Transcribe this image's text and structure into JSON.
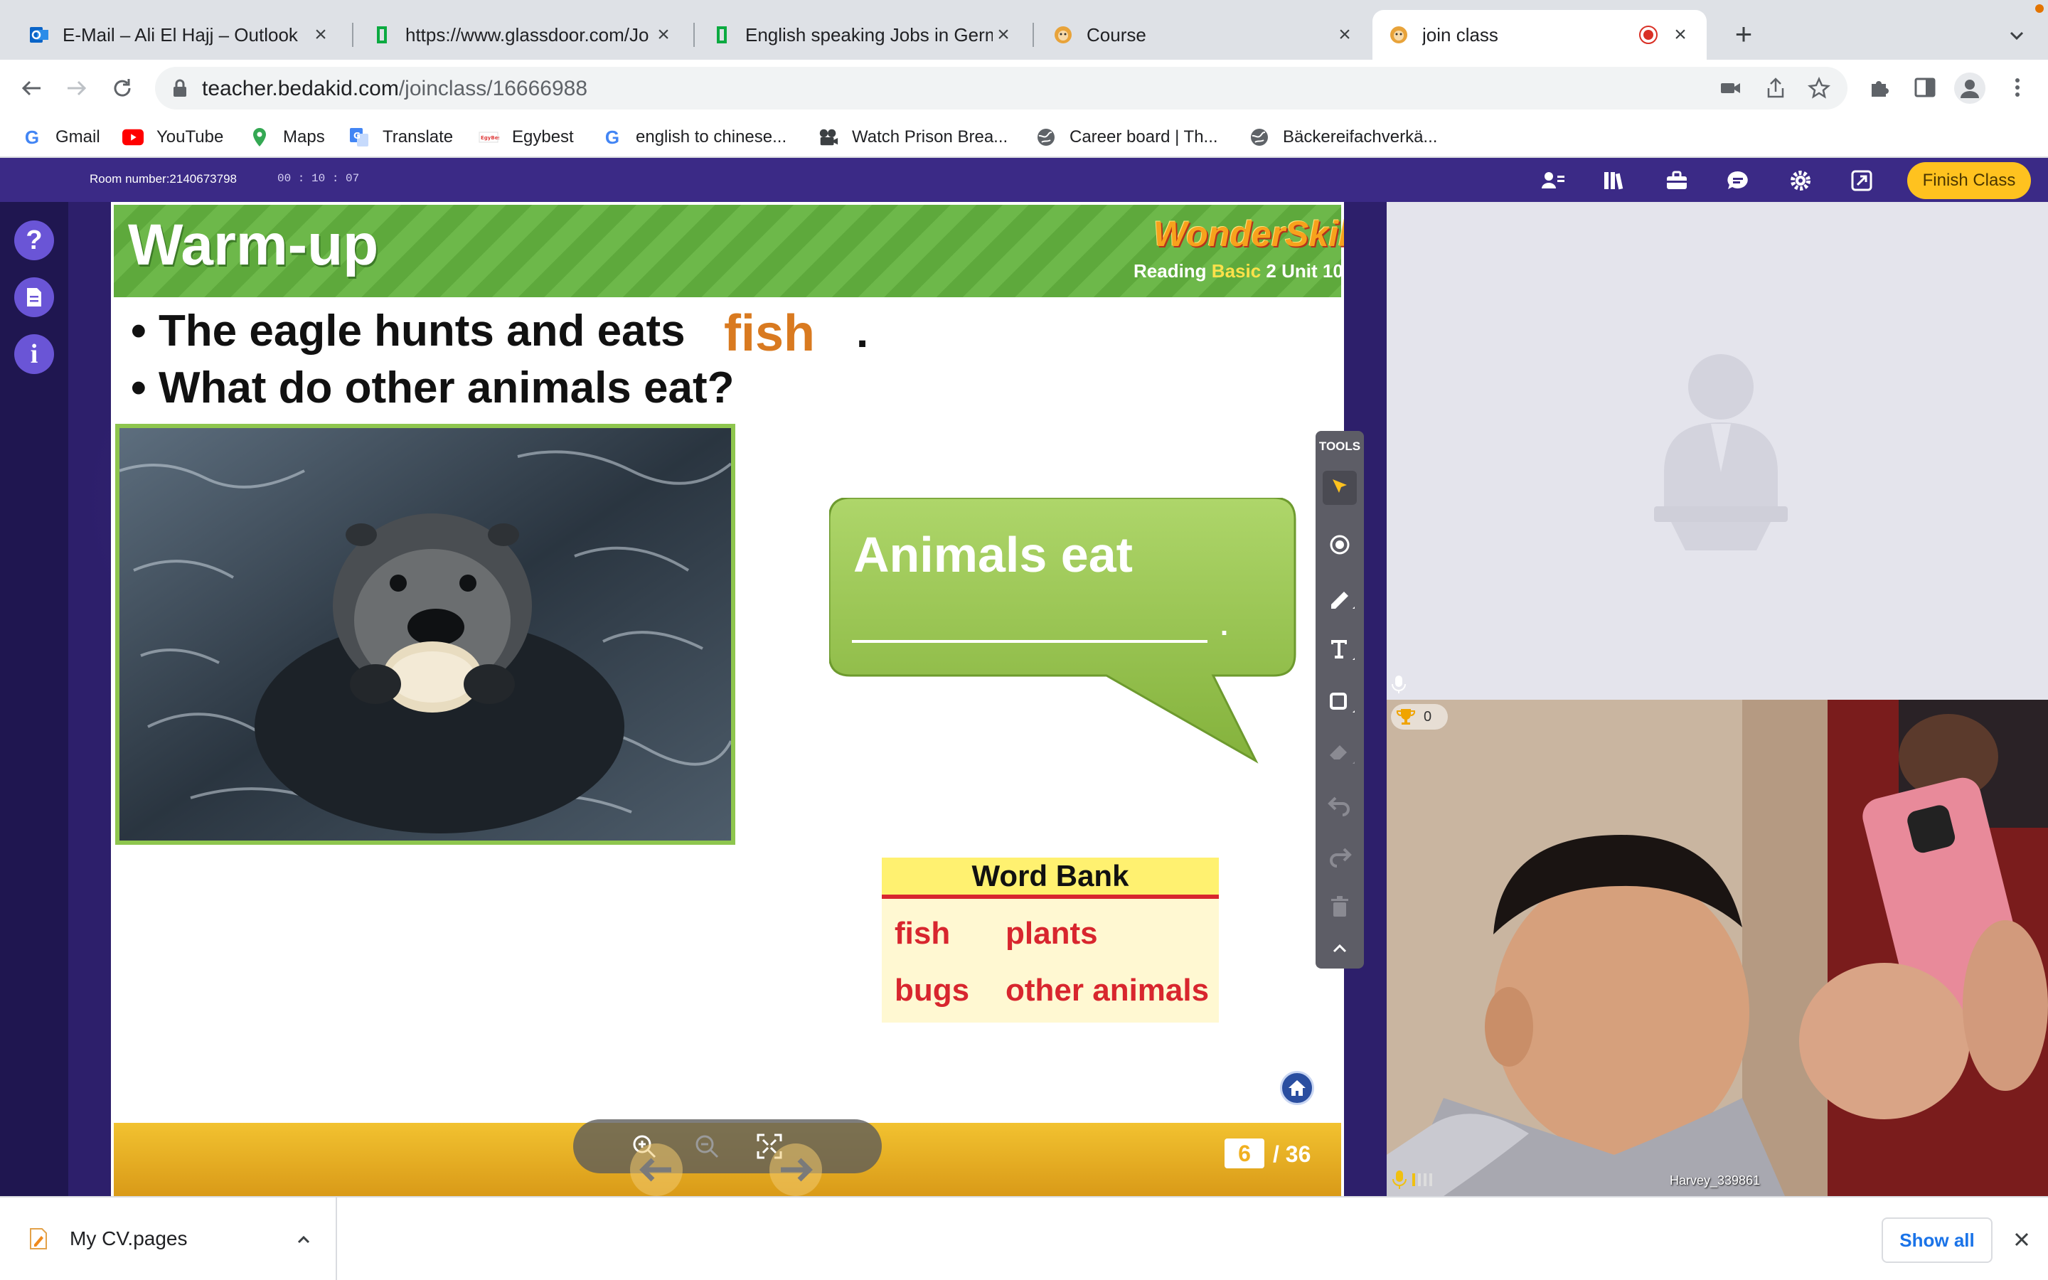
{
  "browser": {
    "tabs": [
      {
        "title": "E-Mail – Ali El Hajj – Outlook",
        "icon": "outlook-icon"
      },
      {
        "title": "https://www.glassdoor.com/Jo",
        "icon": "glassdoor-icon"
      },
      {
        "title": "English speaking Jobs in Germ",
        "icon": "glassdoor-icon"
      },
      {
        "title": "Course",
        "icon": "bedakid-icon"
      },
      {
        "title": "join class",
        "icon": "bedakid-icon",
        "active": true
      }
    ],
    "url_host": "teacher.bedakid.com",
    "url_path": "/joinclass/16666988",
    "bookmarks": [
      {
        "label": "Gmail",
        "icon": "google-icon"
      },
      {
        "label": "YouTube",
        "icon": "youtube-icon"
      },
      {
        "label": "Maps",
        "icon": "maps-icon"
      },
      {
        "label": "Translate",
        "icon": "translate-icon"
      },
      {
        "label": "Egybest",
        "icon": "egybest-icon"
      },
      {
        "label": "english to chinese...",
        "icon": "google-icon"
      },
      {
        "label": "Watch Prison Brea...",
        "icon": "film-icon"
      },
      {
        "label": "Career board | Th...",
        "icon": "globe-icon"
      },
      {
        "label": "Bäckereifachverkä...",
        "icon": "globe-icon"
      }
    ]
  },
  "classroom": {
    "room_number": "Room number:2140673798",
    "timer": "00 : 10 : 07",
    "finish_label": "Finish Class",
    "tools_label": "TOOLS"
  },
  "slide": {
    "title": "Warm-up",
    "brand": "WonderSkills",
    "subtitle_pre": "Reading ",
    "subtitle_basic": "Basic",
    "subtitle_post": " 2 Unit 10",
    "bullet1": "The eagle hunts and eats",
    "answer": "fish",
    "period": ".",
    "bullet2": "What do other animals eat?",
    "bubble_text": "Animals eat",
    "bubble_period": ".",
    "word_bank_title": "Word Bank",
    "words": [
      "fish",
      "plants",
      "bugs",
      "other animals"
    ],
    "page_current": "6",
    "page_total": "/ 36"
  },
  "student": {
    "name": "Harvey_339861",
    "trophy_count": "0"
  },
  "downloads": {
    "file": "My CV.pages",
    "show_all": "Show all"
  },
  "colors": {
    "accent_purple": "#3b2a86",
    "finish_yellow": "#ffc21f",
    "answer_orange": "#d97a20",
    "word_red": "#d8262e",
    "slide_green": "#6db84a"
  }
}
